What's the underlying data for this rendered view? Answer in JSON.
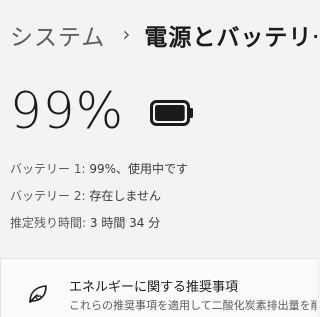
{
  "breadcrumb": {
    "parent": "システム",
    "separator": "›",
    "current": "電源とバッテリー"
  },
  "battery": {
    "percent_text": "99%",
    "level": 0.99,
    "icon": "battery-full-icon"
  },
  "details": [
    {
      "label": "バッテリー 1:",
      "value": "99%、使用中です"
    },
    {
      "label": "バッテリー 2:",
      "value": "存在しません"
    },
    {
      "label": "推定残り時間:",
      "value": "3 時間 34 分"
    }
  ],
  "recommendation_card": {
    "icon": "leaf-heart-icon",
    "title": "エネルギーに関する推奨事項",
    "description": "これらの推奨事項を適用して二酸化炭素排出量を削減"
  },
  "colors": {
    "background": "#f3f3f3",
    "card": "#fbfbfb",
    "text": "#1b1b1b",
    "secondary_text": "#5d5d5d"
  }
}
